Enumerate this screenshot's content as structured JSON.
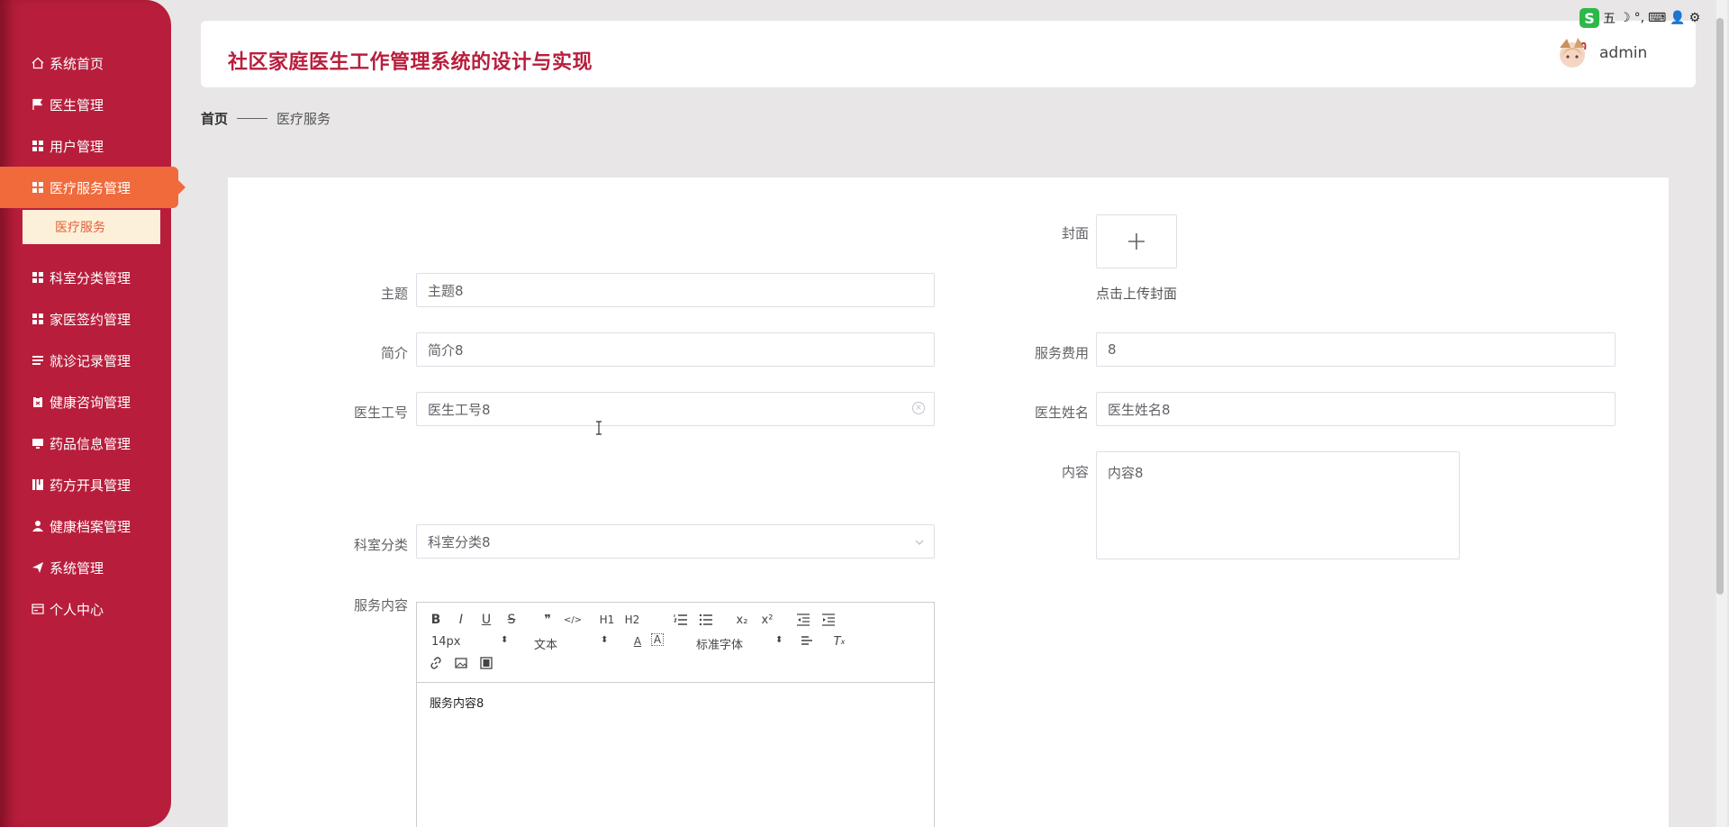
{
  "app": {
    "title": "社区家庭医生工作管理系统的设计与实现"
  },
  "user": {
    "name": "admin"
  },
  "tray": {
    "logo": "S",
    "items": [
      "五",
      "☽",
      "°,",
      "⌨",
      "👤",
      "⚙"
    ]
  },
  "sidebar": {
    "items": [
      {
        "label": "系统首页",
        "icon": "home-icon"
      },
      {
        "label": "医生管理",
        "icon": "flag-icon"
      },
      {
        "label": "用户管理",
        "icon": "grid-icon"
      },
      {
        "label": "医疗服务管理",
        "icon": "grid-icon",
        "active": true
      },
      {
        "label": "科室分类管理",
        "icon": "grid-icon"
      },
      {
        "label": "家医签约管理",
        "icon": "grid-icon"
      },
      {
        "label": "就诊记录管理",
        "icon": "list-icon"
      },
      {
        "label": "健康咨询管理",
        "icon": "clipboard-icon"
      },
      {
        "label": "药品信息管理",
        "icon": "monitor-icon"
      },
      {
        "label": "药方开具管理",
        "icon": "book-icon"
      },
      {
        "label": "健康档案管理",
        "icon": "user-icon"
      },
      {
        "label": "系统管理",
        "icon": "send-icon"
      },
      {
        "label": "个人中心",
        "icon": "card-icon"
      }
    ],
    "subitem": "医疗服务"
  },
  "breadcrumb": {
    "home": "首页",
    "current": "医疗服务"
  },
  "form": {
    "cover_label": "封面",
    "upload_tip": "点击上传封面",
    "subject_label": "主题",
    "subject_value": "主题8",
    "intro_label": "简介",
    "intro_value": "简介8",
    "fee_label": "服务费用",
    "fee_value": "8",
    "doctor_no_label": "医生工号",
    "doctor_no_value": "医生工号8",
    "doctor_name_label": "医生姓名",
    "doctor_name_value": "医生姓名8",
    "content_label": "内容",
    "content_value": "内容8",
    "dept_label": "科室分类",
    "dept_value": "科室分类8",
    "service_label": "服务内容",
    "service_value": "服务内容8"
  },
  "editor": {
    "font_size": "14px",
    "text_type": "文本",
    "font_family": "标准字体",
    "buttons_row1": [
      "B",
      "I",
      "U",
      "S",
      "❞",
      "</>",
      "H1",
      "H2",
      "ol",
      "ul",
      "x₂",
      "x²",
      "outdent",
      "indent"
    ]
  }
}
